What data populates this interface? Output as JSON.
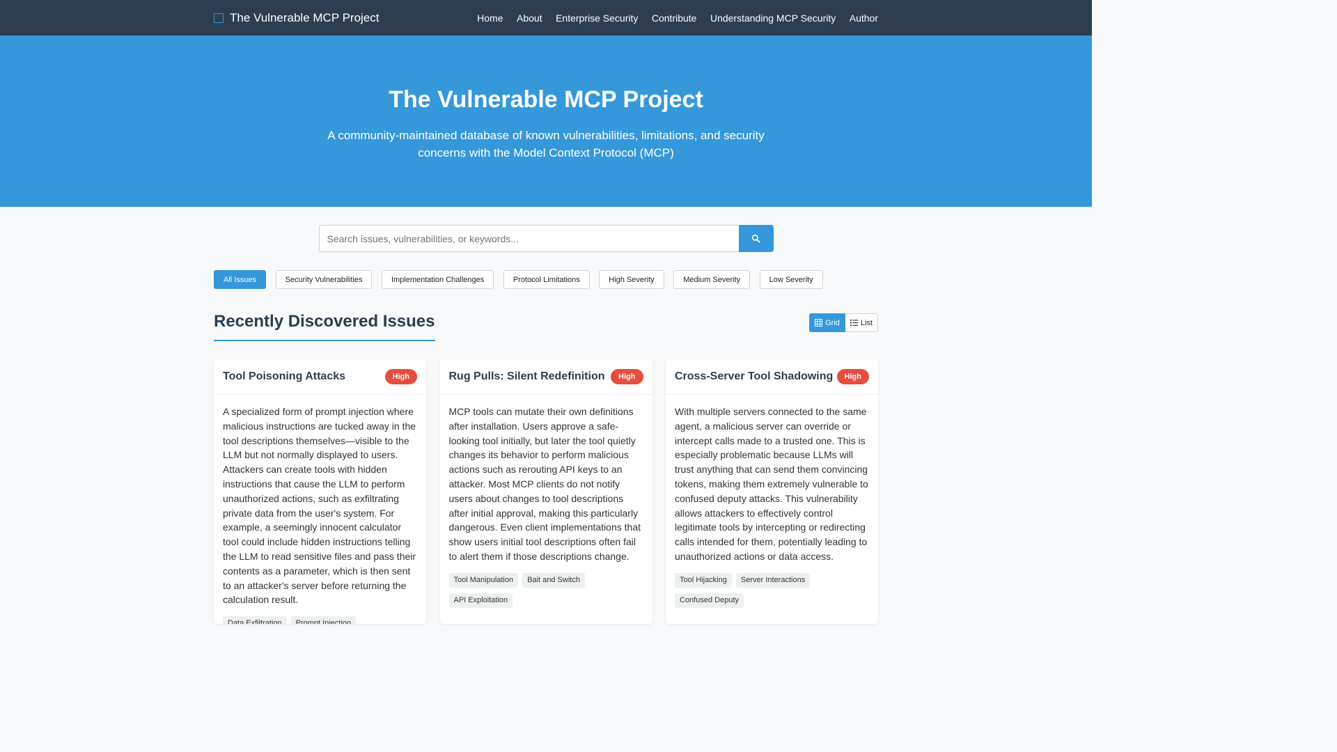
{
  "nav": {
    "brand": "The Vulnerable MCP Project",
    "links": [
      "Home",
      "About",
      "Enterprise Security",
      "Contribute",
      "Understanding MCP Security",
      "Author"
    ]
  },
  "hero": {
    "title": "The Vulnerable MCP Project",
    "subtitle": "A community-maintained database of known vulnerabilities, limitations, and security concerns with the Model Context Protocol (MCP)"
  },
  "search": {
    "placeholder": "Search issues, vulnerabilities, or keywords...",
    "value": ""
  },
  "filters": [
    "All Issues",
    "Security Vulnerabilities",
    "Implementation Challenges",
    "Protocol Limitations",
    "High Severity",
    "Medium Severity",
    "Low Severity"
  ],
  "section": {
    "title": "Recently Discovered Issues",
    "view_grid": "Grid",
    "view_list": "List"
  },
  "cards": [
    {
      "title": "Tool Poisoning Attacks",
      "severity": "High",
      "description": "A specialized form of prompt injection where malicious instructions are tucked away in the tool descriptions themselves—visible to the LLM but not normally displayed to users. Attackers can create tools with hidden instructions that cause the LLM to perform unauthorized actions, such as exfiltrating private data from the user's system. For example, a seemingly innocent calculator tool could include hidden instructions telling the LLM to read sensitive files and pass their contents as a parameter, which is then sent to an attacker's server before returning the calculation result.",
      "tags": [
        "Data Exfiltration",
        "Prompt Injection"
      ]
    },
    {
      "title": "Rug Pulls: Silent Redefinition",
      "severity": "High",
      "description": "MCP tools can mutate their own definitions after installation. Users approve a safe-looking tool initially, but later the tool quietly changes its behavior to perform malicious actions such as rerouting API keys to an attacker. Most MCP clients do not notify users about changes to tool descriptions after initial approval, making this particularly dangerous. Even client implementations that show users initial tool descriptions often fail to alert them if those descriptions change.",
      "tags": [
        "Tool Manipulation",
        "Bait and Switch",
        "API Exploitation"
      ]
    },
    {
      "title": "Cross-Server Tool Shadowing",
      "severity": "High",
      "description": "With multiple servers connected to the same agent, a malicious server can override or intercept calls made to a trusted one. This is especially problematic because LLMs will trust anything that can send them convincing tokens, making them extremely vulnerable to confused deputy attacks. This vulnerability allows attackers to effectively control legitimate tools by intercepting or redirecting calls intended for them, potentially leading to unauthorized actions or data access.",
      "tags": [
        "Tool Hijacking",
        "Server Interactions",
        "Confused Deputy"
      ]
    }
  ]
}
